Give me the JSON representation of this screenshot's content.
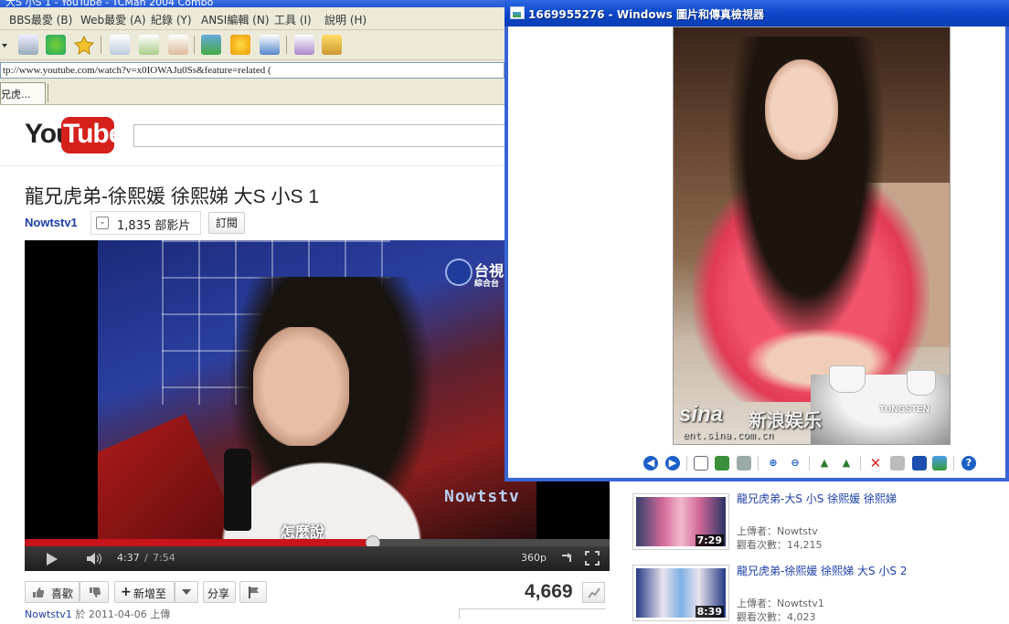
{
  "browser": {
    "title": "大S 小S 1 - YouTube - TCMan 2004 Combo",
    "menu": [
      "BBS最愛 (B)",
      "Web最愛 (A)",
      "紀錄 (Y)",
      "ANSI編輯 (N)",
      "工具 (I)",
      "說明 (H)"
    ],
    "address": "tp://www.youtube.com/watch?v=x0IOWAJu0Ss&feature=related (",
    "tab_label": "兄虎..."
  },
  "youtube": {
    "logo_you": "You",
    "logo_tube": "Tube",
    "video_title": "龍兄虎弟-徐熙媛 徐熙娣 大S 小S 1",
    "channel": "Nowtstv1",
    "video_count": "1,835 部影片",
    "subscribe": "訂閱",
    "player": {
      "progress": 0.596,
      "time_current": "4:37",
      "time_separator": "/",
      "time_duration": "7:54",
      "quality": "360p",
      "watermark": "Nowtstv",
      "subtitle": "怎麼說",
      "station_logo": "台視",
      "station_sub": "綜合台"
    },
    "actions": {
      "like": "喜歡",
      "add_to": "新增至",
      "share": "分享"
    },
    "view_count": "4,669",
    "uploader_prefix": "Nowtstv1",
    "uploader_line": " 於 2011-04-06 上傳"
  },
  "related": [
    {
      "title": "龍兄虎弟-大S 小S 徐熙媛 徐熙娣",
      "uploader": "上傳者：Nowtstv",
      "views": "觀看次數：14,215",
      "duration": "7:29"
    },
    {
      "title": "龍兄虎弟-徐熙媛 徐熙娣 大S 小S 2",
      "uploader": "上傳者：Nowtstv1",
      "views": "觀看次數：4,023",
      "duration": "8:39"
    }
  ],
  "viewer": {
    "title": "1669955276 - Windows 圖片和傳真檢視器",
    "watermark_brand": "sina",
    "watermark_cn": "新浪娱乐",
    "watermark_url": "ent.sina.com.cn",
    "tungsten": "TUNGSTEN"
  },
  "colors": {
    "yt_red": "#d6201b",
    "xp_title": "#0b46c8",
    "link_blue": "#1c3fa8"
  }
}
